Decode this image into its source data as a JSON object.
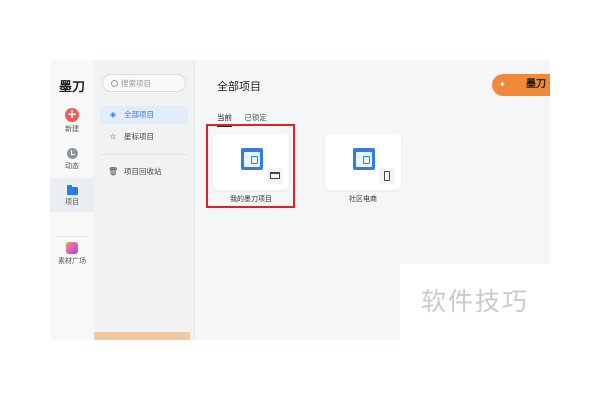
{
  "app": {
    "logo": "墨刀",
    "rail": [
      {
        "id": "new",
        "label": "新建",
        "icon": "plus-icon"
      },
      {
        "id": "activity",
        "label": "动态",
        "icon": "activity-icon"
      },
      {
        "id": "projects",
        "label": "项目",
        "icon": "folder-icon",
        "active": true
      },
      {
        "id": "materials",
        "label": "素材广场",
        "icon": "materials-icon"
      }
    ]
  },
  "sidebar": {
    "search_placeholder": "搜索项目",
    "items": [
      {
        "label": "全部项目",
        "icon": "layers-icon",
        "active": true
      },
      {
        "label": "星标项目",
        "icon": "star-icon"
      },
      {
        "label": "项目回收站",
        "icon": "trash-icon"
      }
    ]
  },
  "main": {
    "title": "全部项目",
    "brand_badge": "墨刀",
    "tabs": [
      {
        "label": "当前",
        "active": true
      },
      {
        "label": "已锁定",
        "active": false
      }
    ],
    "projects": [
      {
        "name": "我的墨刀项目",
        "device": "desktop-icon",
        "highlighted": true
      },
      {
        "name": "社区电商",
        "device": "mobile-icon",
        "highlighted": false
      }
    ]
  },
  "watermark": "软件技巧",
  "colors": {
    "accent": "#2d7be5",
    "new_button": "#ef5a5a",
    "brand_badge": "#f08a3a",
    "highlight_box": "#d6262c"
  }
}
